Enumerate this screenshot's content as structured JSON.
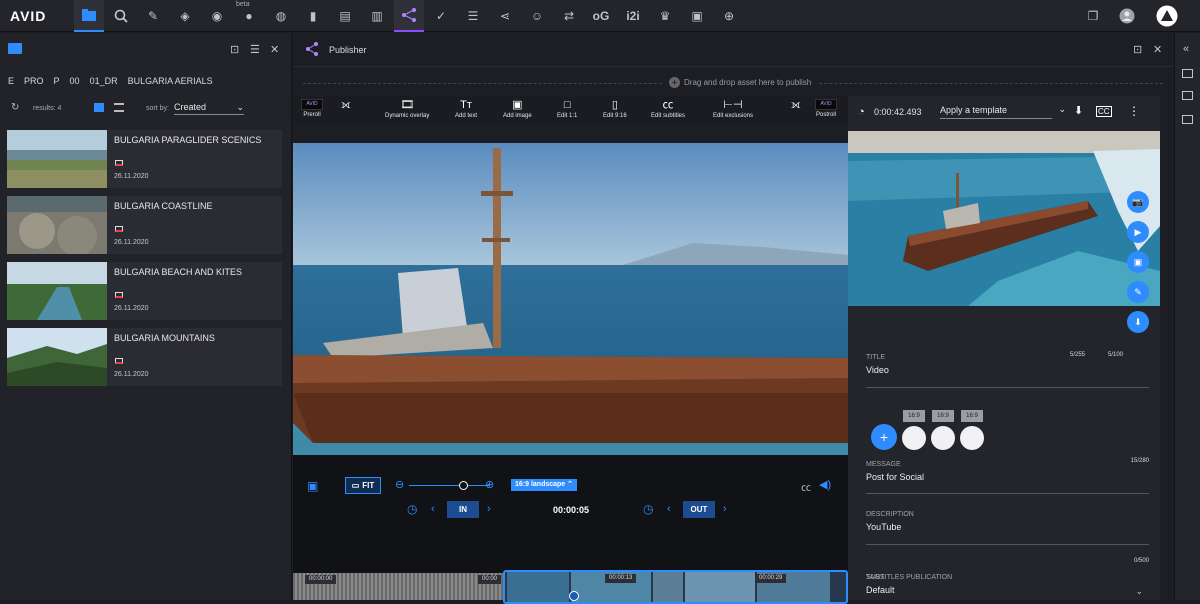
{
  "app": {
    "logo": "AVID"
  },
  "topbar": {
    "beta_label": "beta"
  },
  "left_panel": {
    "breadcrumb": [
      "E",
      "PRO",
      "P",
      "00",
      "01_DR",
      "BULGARIA AERIALS"
    ],
    "results": "results: 4",
    "sort_label": "sort by:",
    "sort_value": "Created",
    "assets": [
      {
        "title": "BULGARIA PARAGLIDER SCENICS",
        "date": "26.11.2020"
      },
      {
        "title": "BULGARIA COASTLINE",
        "date": "26.11.2020"
      },
      {
        "title": "BULGARIA BEACH AND KITES",
        "date": "26.11.2020"
      },
      {
        "title": "BULGARIA MOUNTAINS",
        "date": "26.11.2020"
      }
    ]
  },
  "publisher": {
    "title": "Publisher",
    "drop_hint": "Drag and drop asset here to publish",
    "tools": {
      "preroll": "Preroll",
      "dynamic_overlay": "Dynamic overlay",
      "add_text": "Add text",
      "add_image": "Add image",
      "edit_1_1": "Edit 1:1",
      "edit_9_16": "Edit 9:16",
      "edit_subtitles": "Edit subtitles",
      "edit_exclusions": "Edit exclusions",
      "postroll": "Postroll"
    },
    "player": {
      "fit_label": "FIT",
      "aspect_label": "16:9 landscape",
      "in_label": "IN",
      "out_label": "OUT",
      "current_time": "00:00:05",
      "timeline_times": [
        "00:00:00",
        "00:00",
        "00:00:13",
        "00:00:29"
      ]
    }
  },
  "right_panel": {
    "duration": "0:00:42.493",
    "template_placeholder": "Apply a template",
    "title_label": "TITLE",
    "title_value": "Video",
    "title_counter_1": "5/255",
    "title_counter_2": "5/100",
    "ratio_tags": [
      "16:9",
      "16:9",
      "16:9"
    ],
    "message_label": "MESSAGE",
    "message_value": "Post for Social",
    "message_counter": "15/280",
    "description_label": "DESCRIPTION",
    "description_value": "YouTube",
    "tags_label": "TAGS",
    "tags_counter": "0/500",
    "subtitles_label": "SUBTITLES PUBLICATION",
    "subtitles_value": "Default"
  }
}
